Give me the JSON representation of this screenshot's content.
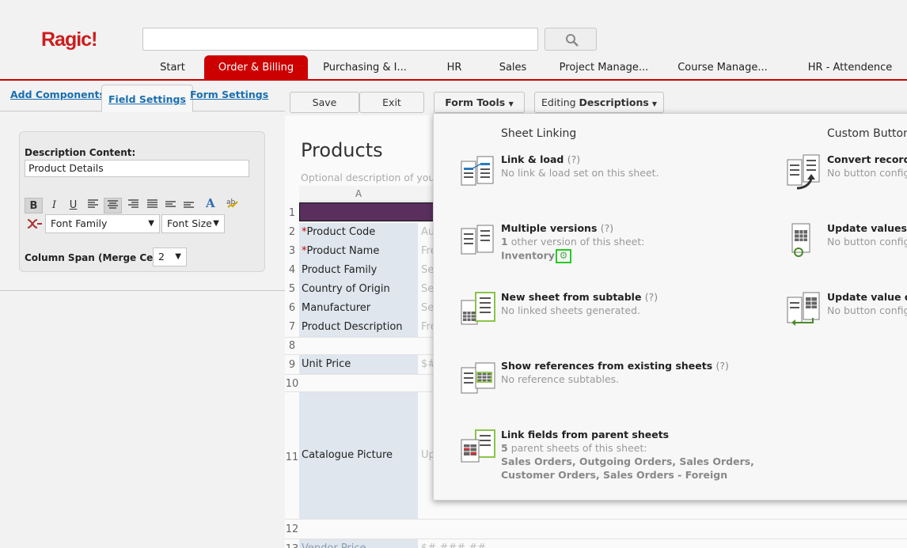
{
  "app": {
    "logo": "Ragic!",
    "search": {
      "placeholder": ""
    },
    "tabs": [
      "Start",
      "Order & Billing",
      "Purchasing & I...",
      "HR",
      "Sales",
      "Project Manage...",
      "Course Manage...",
      "HR - Attendence"
    ],
    "active_tab": "Order & Billing"
  },
  "left_panel": {
    "tabs": [
      "Add Components",
      "Field Settings",
      "Form Settings"
    ],
    "active_tab": "Field Settings",
    "description_label": "Description Content:",
    "description_value": "Product Details",
    "format_buttons": [
      "B",
      "I",
      "U"
    ],
    "font_family": "Font Family",
    "font_size": "Font Size",
    "column_span_label": "Column Span (Merge Cells):",
    "column_span_value": "2"
  },
  "toolbar": {
    "save": "Save",
    "exit": "Exit",
    "form_tools": "Form Tools",
    "editing_prefix": "Editing",
    "editing_mode": "Descriptions"
  },
  "sheet": {
    "title": "Products",
    "description_placeholder": "Optional description of your",
    "column_a": "A",
    "rows": [
      {
        "num": "1",
        "label": "",
        "required": false,
        "hint": ""
      },
      {
        "num": "2",
        "label": "Product Code",
        "required": true,
        "hint": "Au"
      },
      {
        "num": "3",
        "label": "Product Name",
        "required": true,
        "hint": "Fre"
      },
      {
        "num": "4",
        "label": "Product Family",
        "required": false,
        "hint": "Se"
      },
      {
        "num": "5",
        "label": "Country of Origin",
        "required": false,
        "hint": "Se"
      },
      {
        "num": "6",
        "label": "Manufacturer",
        "required": false,
        "hint": "Se"
      },
      {
        "num": "7",
        "label": "Product Description",
        "required": false,
        "hint": "Fre"
      },
      {
        "num": "8",
        "label": "",
        "required": false,
        "hint": ""
      },
      {
        "num": "9",
        "label": "Unit Price",
        "required": false,
        "hint": "$#"
      },
      {
        "num": "10",
        "label": "",
        "required": false,
        "hint": ""
      },
      {
        "num": "11",
        "label": "Catalogue Picture",
        "required": false,
        "hint": "Up"
      },
      {
        "num": "12",
        "label": "",
        "required": false,
        "hint": ""
      },
      {
        "num": "13",
        "label": "Vendor Price",
        "required": false,
        "hint": "$# ### ##"
      }
    ]
  },
  "form_tools_menu": {
    "sheet_linking_heading": "Sheet Linking",
    "custom_buttons_heading": "Custom Buttons",
    "help": "(?)",
    "items": [
      {
        "title": "Link & load",
        "lines": [
          "No link & load set on this sheet."
        ]
      },
      {
        "title": "Multiple versions",
        "count": "1",
        "line": "other version of this sheet:",
        "link": "Inventory"
      },
      {
        "title": "New sheet from subtable",
        "lines": [
          "No linked sheets generated."
        ]
      },
      {
        "title": "Show references from existing sheets",
        "lines": [
          "No reference subtables."
        ]
      },
      {
        "title": "Link fields from parent sheets",
        "count": "5",
        "line": "parent sheets of this sheet:",
        "parents_line1": "Sales Orders, Outgoing Orders, Sales Orders,",
        "parents_line2": "Customer Orders, Sales Orders - Foreign"
      }
    ],
    "custom_items": [
      {
        "title": "Convert records",
        "line": "No button configu"
      },
      {
        "title": "Update values",
        "line": "No button configu"
      },
      {
        "title": "Update value on",
        "line": "No button configu"
      }
    ]
  },
  "colors": {
    "brand_red": "#cc0000",
    "title_row": "#5a2f5e",
    "label_cell": "#dfe6ee",
    "link_blue": "#1a6fb0",
    "highlight_green": "#22cc22"
  }
}
